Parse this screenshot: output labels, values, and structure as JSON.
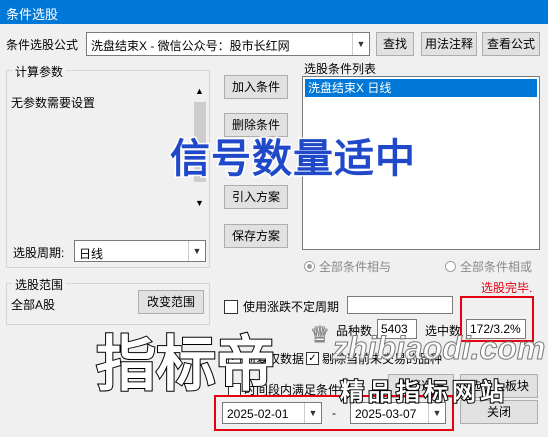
{
  "window": {
    "title": "条件选股"
  },
  "formula": {
    "label": "条件选股公式",
    "value": "洗盘结束X  -  微信公众号：股市长红网",
    "buttons": {
      "find": "查找",
      "usage": "用法注释",
      "view": "查看公式"
    }
  },
  "params": {
    "legend": "计算参数",
    "text": "无参数需要设置"
  },
  "period": {
    "label": "选股周期:",
    "value": "日线"
  },
  "actions": {
    "add": "加入条件",
    "delete": "删除条件",
    "import": "引入方案",
    "save": "保存方案"
  },
  "condition_list": {
    "legend": "选股条件列表",
    "items": [
      "洗盘结束X  日线"
    ]
  },
  "logic": {
    "and_label": "全部条件相与",
    "or_label": "全部条件相或"
  },
  "status": {
    "done": "选股完毕."
  },
  "scope": {
    "legend": "选股范围",
    "value": "全部A股",
    "change_button": "改变范围"
  },
  "options": {
    "use_changing_period": "使用涨跌不定周期",
    "pre_adjust": "前复权数据",
    "exclude": "剔除当前未交易的品种",
    "time_section": "时间段内满足条件"
  },
  "stats": {
    "count_label": "品种数",
    "count": "5403",
    "selected_label": "选中数",
    "selected": "172/3.2%"
  },
  "dates": {
    "from": "2025-02-01",
    "sep": "-",
    "to": "2025-03-07"
  },
  "bottom": {
    "execute": "执行选股",
    "board": "选股入板块",
    "close": "关闭"
  },
  "overlays": {
    "headline": "信号数量适中",
    "brand": "指标帝",
    "site": "zhibiaodi.com",
    "slogan": "精品指标网站"
  },
  "colors": {
    "title_bg": "#0078d7",
    "selection": "#0078d7",
    "status_red": "#e60012",
    "headline": "#1f49c9"
  }
}
